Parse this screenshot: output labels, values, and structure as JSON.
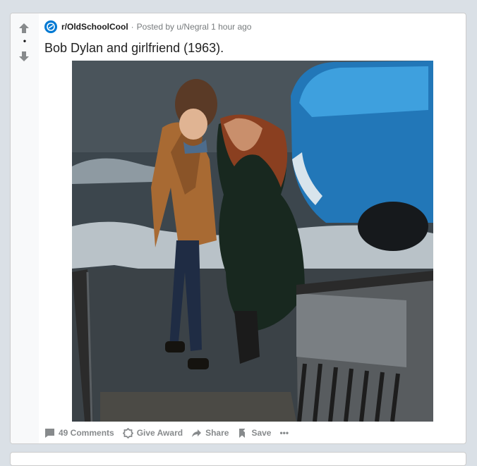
{
  "post": {
    "score": "•",
    "subreddit": "r/OldSchoolCool",
    "separator": "·",
    "posted_by_prefix": "Posted by",
    "author": "u/Negral",
    "time_ago": "1 hour ago",
    "title": "Bob Dylan and girlfriend (1963).",
    "image": {
      "subject": "photo-bob-dylan-and-girlfriend"
    },
    "actions": {
      "comments": "49 Comments",
      "award": "Give Award",
      "share": "Share",
      "save": "Save",
      "more": "•••"
    }
  },
  "icons": {
    "upvote": "arrow-up-icon",
    "downvote": "arrow-down-icon",
    "subreddit": "subreddit-icon",
    "comments": "comment-icon",
    "award": "award-icon",
    "share": "share-icon",
    "save": "bookmark-icon"
  },
  "colors": {
    "page_background": "#dae0e6",
    "card_background": "#ffffff",
    "vote_rail": "#f8f9fa",
    "subreddit_icon": "#0079d3",
    "meta_text": "#787c7e",
    "action_text": "#878a8c",
    "title_text": "#222222"
  }
}
